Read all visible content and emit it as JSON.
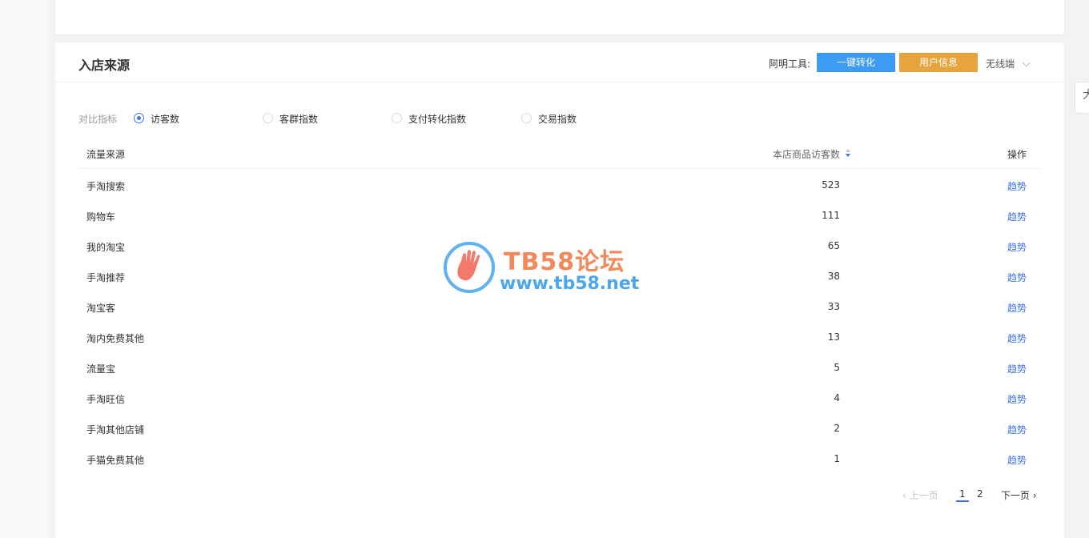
{
  "section": {
    "title": "入店来源",
    "tools_label": "阿明工具:",
    "btn_convert": "一键转化",
    "btn_userinfo": "用户信息",
    "device": "无线端"
  },
  "metrics": {
    "label": "对比指标",
    "options": [
      "访客数",
      "客群指数",
      "支付转化指数",
      "交易指数"
    ],
    "selected": "访客数"
  },
  "table": {
    "headers": {
      "source": "流量来源",
      "visits": "本店商品访客数",
      "action": "操作"
    },
    "rows": [
      {
        "source": "手淘搜索",
        "visits": "523",
        "action": "趋势"
      },
      {
        "source": "购物车",
        "visits": "111",
        "action": "趋势"
      },
      {
        "source": "我的淘宝",
        "visits": "65",
        "action": "趋势"
      },
      {
        "source": "手淘推荐",
        "visits": "38",
        "action": "趋势"
      },
      {
        "source": "淘宝客",
        "visits": "33",
        "action": "趋势"
      },
      {
        "source": "淘内免费其他",
        "visits": "13",
        "action": "趋势"
      },
      {
        "source": "流量宝",
        "visits": "5",
        "action": "趋势"
      },
      {
        "source": "手淘旺信",
        "visits": "4",
        "action": "趋势"
      },
      {
        "source": "手淘其他店铺",
        "visits": "2",
        "action": "趋势"
      },
      {
        "source": "手猫免费其他",
        "visits": "1",
        "action": "趋势"
      }
    ]
  },
  "pager": {
    "prev": "上一页",
    "pages": [
      "1",
      "2"
    ],
    "current": "1",
    "next": "下一页"
  },
  "right_tab": "大",
  "watermark": {
    "title": "TB58论坛",
    "url": "www.tb58.net"
  },
  "colors": {
    "accent": "#3b73f0",
    "btn_blue": "#3d9bf5",
    "btn_orange": "#e8a43c"
  }
}
